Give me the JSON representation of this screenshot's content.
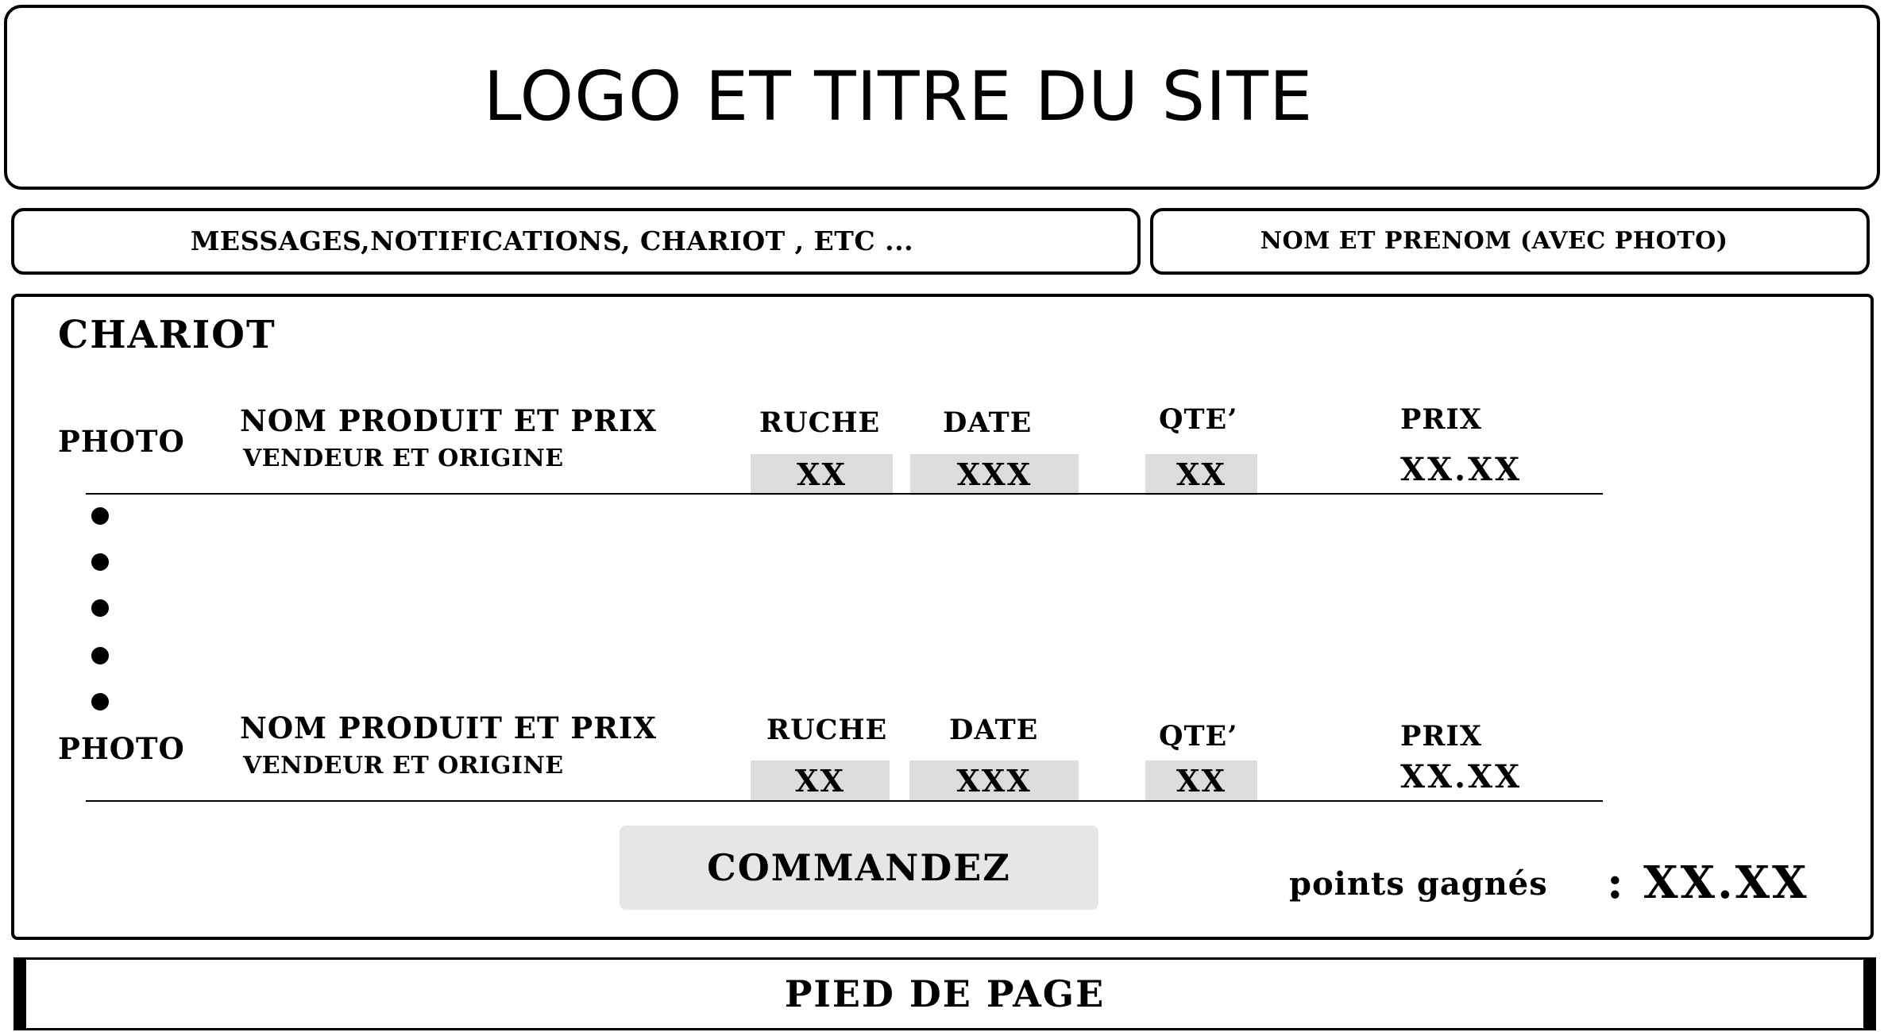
{
  "header": {
    "title": "LOGO ET TITRE DU SITE"
  },
  "nav": {
    "left_text": "MESSAGES,NOTIFICATIONS, CHARIOT , ETC ...",
    "right_text": "NOM ET PRENOM   (AVEC PHOTO)"
  },
  "cart": {
    "title": "CHARIOT",
    "items": [
      {
        "photo": "PHOTO",
        "product": "NOM PRODUIT ET PRIX",
        "seller": "VENDEUR ET ORIGINE",
        "ruche_label": "RUCHE",
        "ruche_value": "XX",
        "date_label": "DATE",
        "date_value": "XXX",
        "qty_label": "QTE’",
        "qty_value": "XX",
        "price_label": "PRIX",
        "price_value": "XX.XX"
      },
      {
        "photo": "PHOTO",
        "product": "NOM PRODUIT ET PRIX",
        "seller": "VENDEUR ET ORIGINE",
        "ruche_label": "RUCHE",
        "ruche_value": "XX",
        "date_label": "DATE",
        "date_value": "XXX",
        "qty_label": "QTE’",
        "qty_value": "XX",
        "price_label": "PRIX",
        "price_value": "XX.XX"
      }
    ],
    "order_button": "COMMANDEZ",
    "points_label": "points gagnés",
    "points_value": ": XX.XX"
  },
  "footer": {
    "text": "PIED DE PAGE"
  }
}
